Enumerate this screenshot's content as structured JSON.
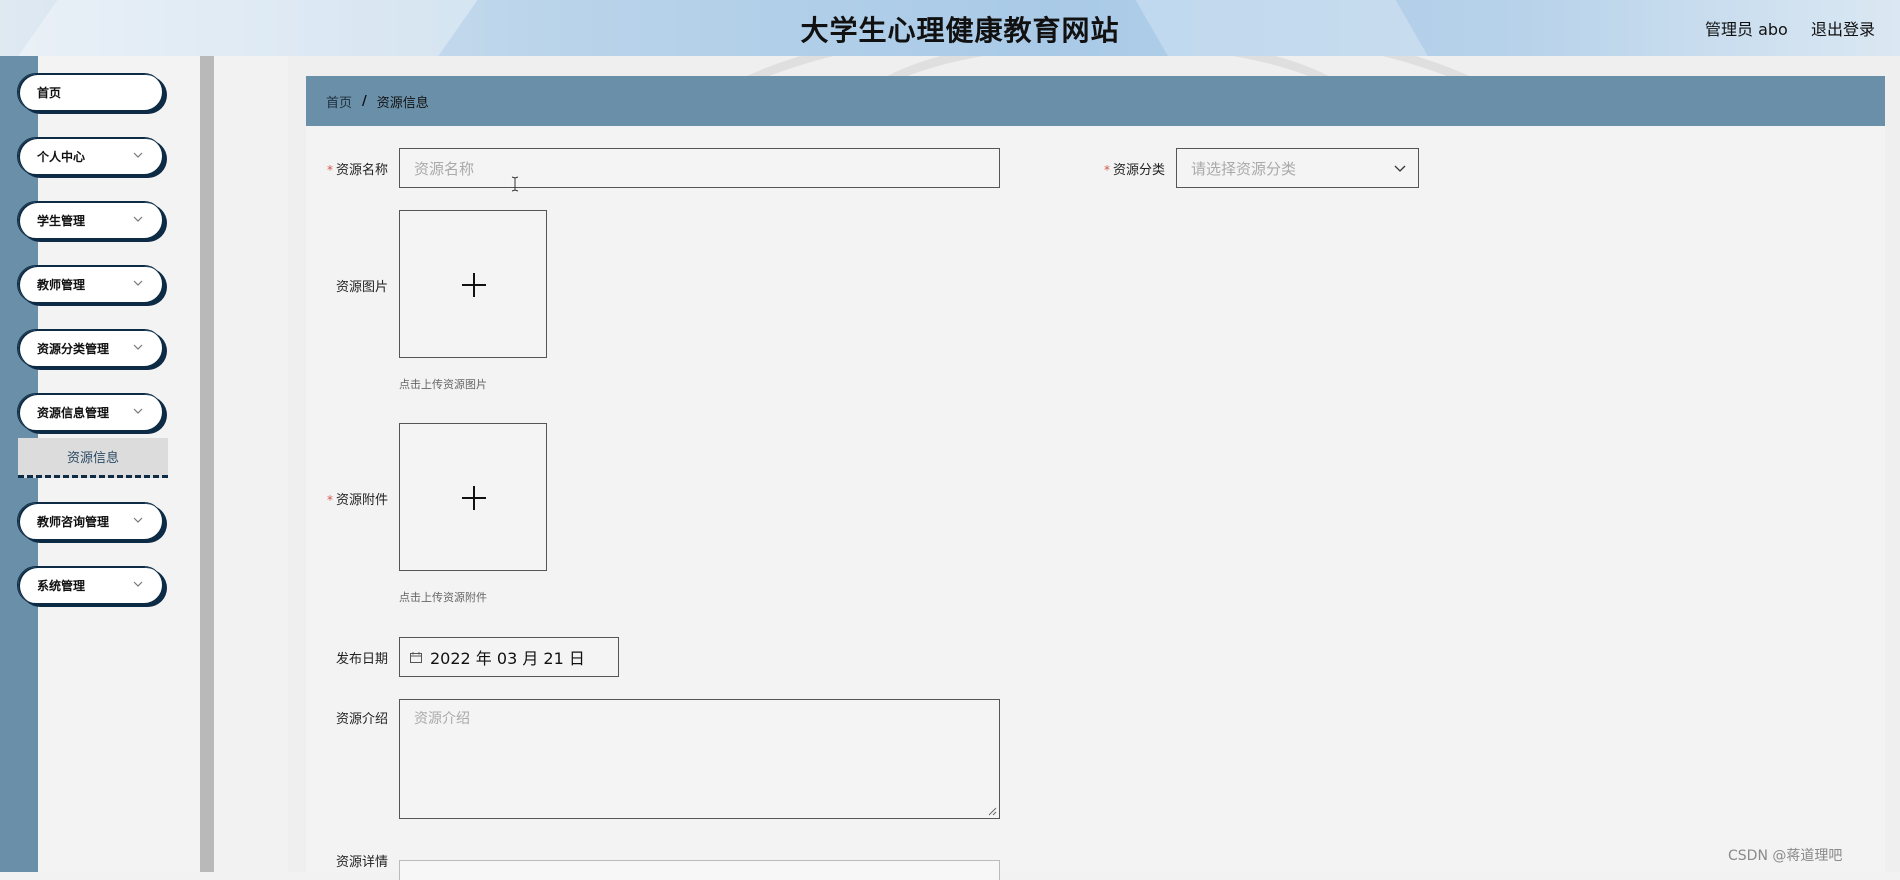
{
  "header": {
    "title": "大学生心理健康教育网站",
    "user": "管理员 abo",
    "logout": "退出登录"
  },
  "sidebar": {
    "items": [
      {
        "label": "首页",
        "icon": "none"
      },
      {
        "label": "个人中心",
        "icon": "chevron-down-icon"
      },
      {
        "label": "学生管理",
        "icon": "chevron-down-icon"
      },
      {
        "label": "教师管理",
        "icon": "chevron-down-icon"
      },
      {
        "label": "资源分类管理",
        "icon": "chevron-down-icon"
      },
      {
        "label": "资源信息管理",
        "icon": "chevron-down-icon"
      },
      {
        "label": "教师咨询管理",
        "icon": "chevron-down-icon"
      },
      {
        "label": "系统管理",
        "icon": "chevron-down-icon"
      }
    ],
    "active_sub_item": "资源信息"
  },
  "breadcrumb": {
    "home": "首页",
    "separator": "/",
    "current": "资源信息"
  },
  "form": {
    "name": {
      "label": "资源名称",
      "placeholder": "资源名称",
      "required": true
    },
    "category": {
      "label": "资源分类",
      "placeholder": "请选择资源分类",
      "required": true
    },
    "image": {
      "label": "资源图片",
      "hint": "点击上传资源图片",
      "required": false
    },
    "attachment": {
      "label": "资源附件",
      "hint": "点击上传资源附件",
      "required": true
    },
    "date": {
      "label": "发布日期",
      "value": "2022 年 03 月 21 日"
    },
    "intro": {
      "label": "资源介绍",
      "placeholder": "资源介绍"
    },
    "detail": {
      "label": "资源详情"
    },
    "required_mark": "*"
  },
  "watermark": "CSDN @蒋道理吧",
  "colors": {
    "accent": "#6a8fa8",
    "menu_border": "#0d2b45",
    "required": "#d9534f"
  }
}
